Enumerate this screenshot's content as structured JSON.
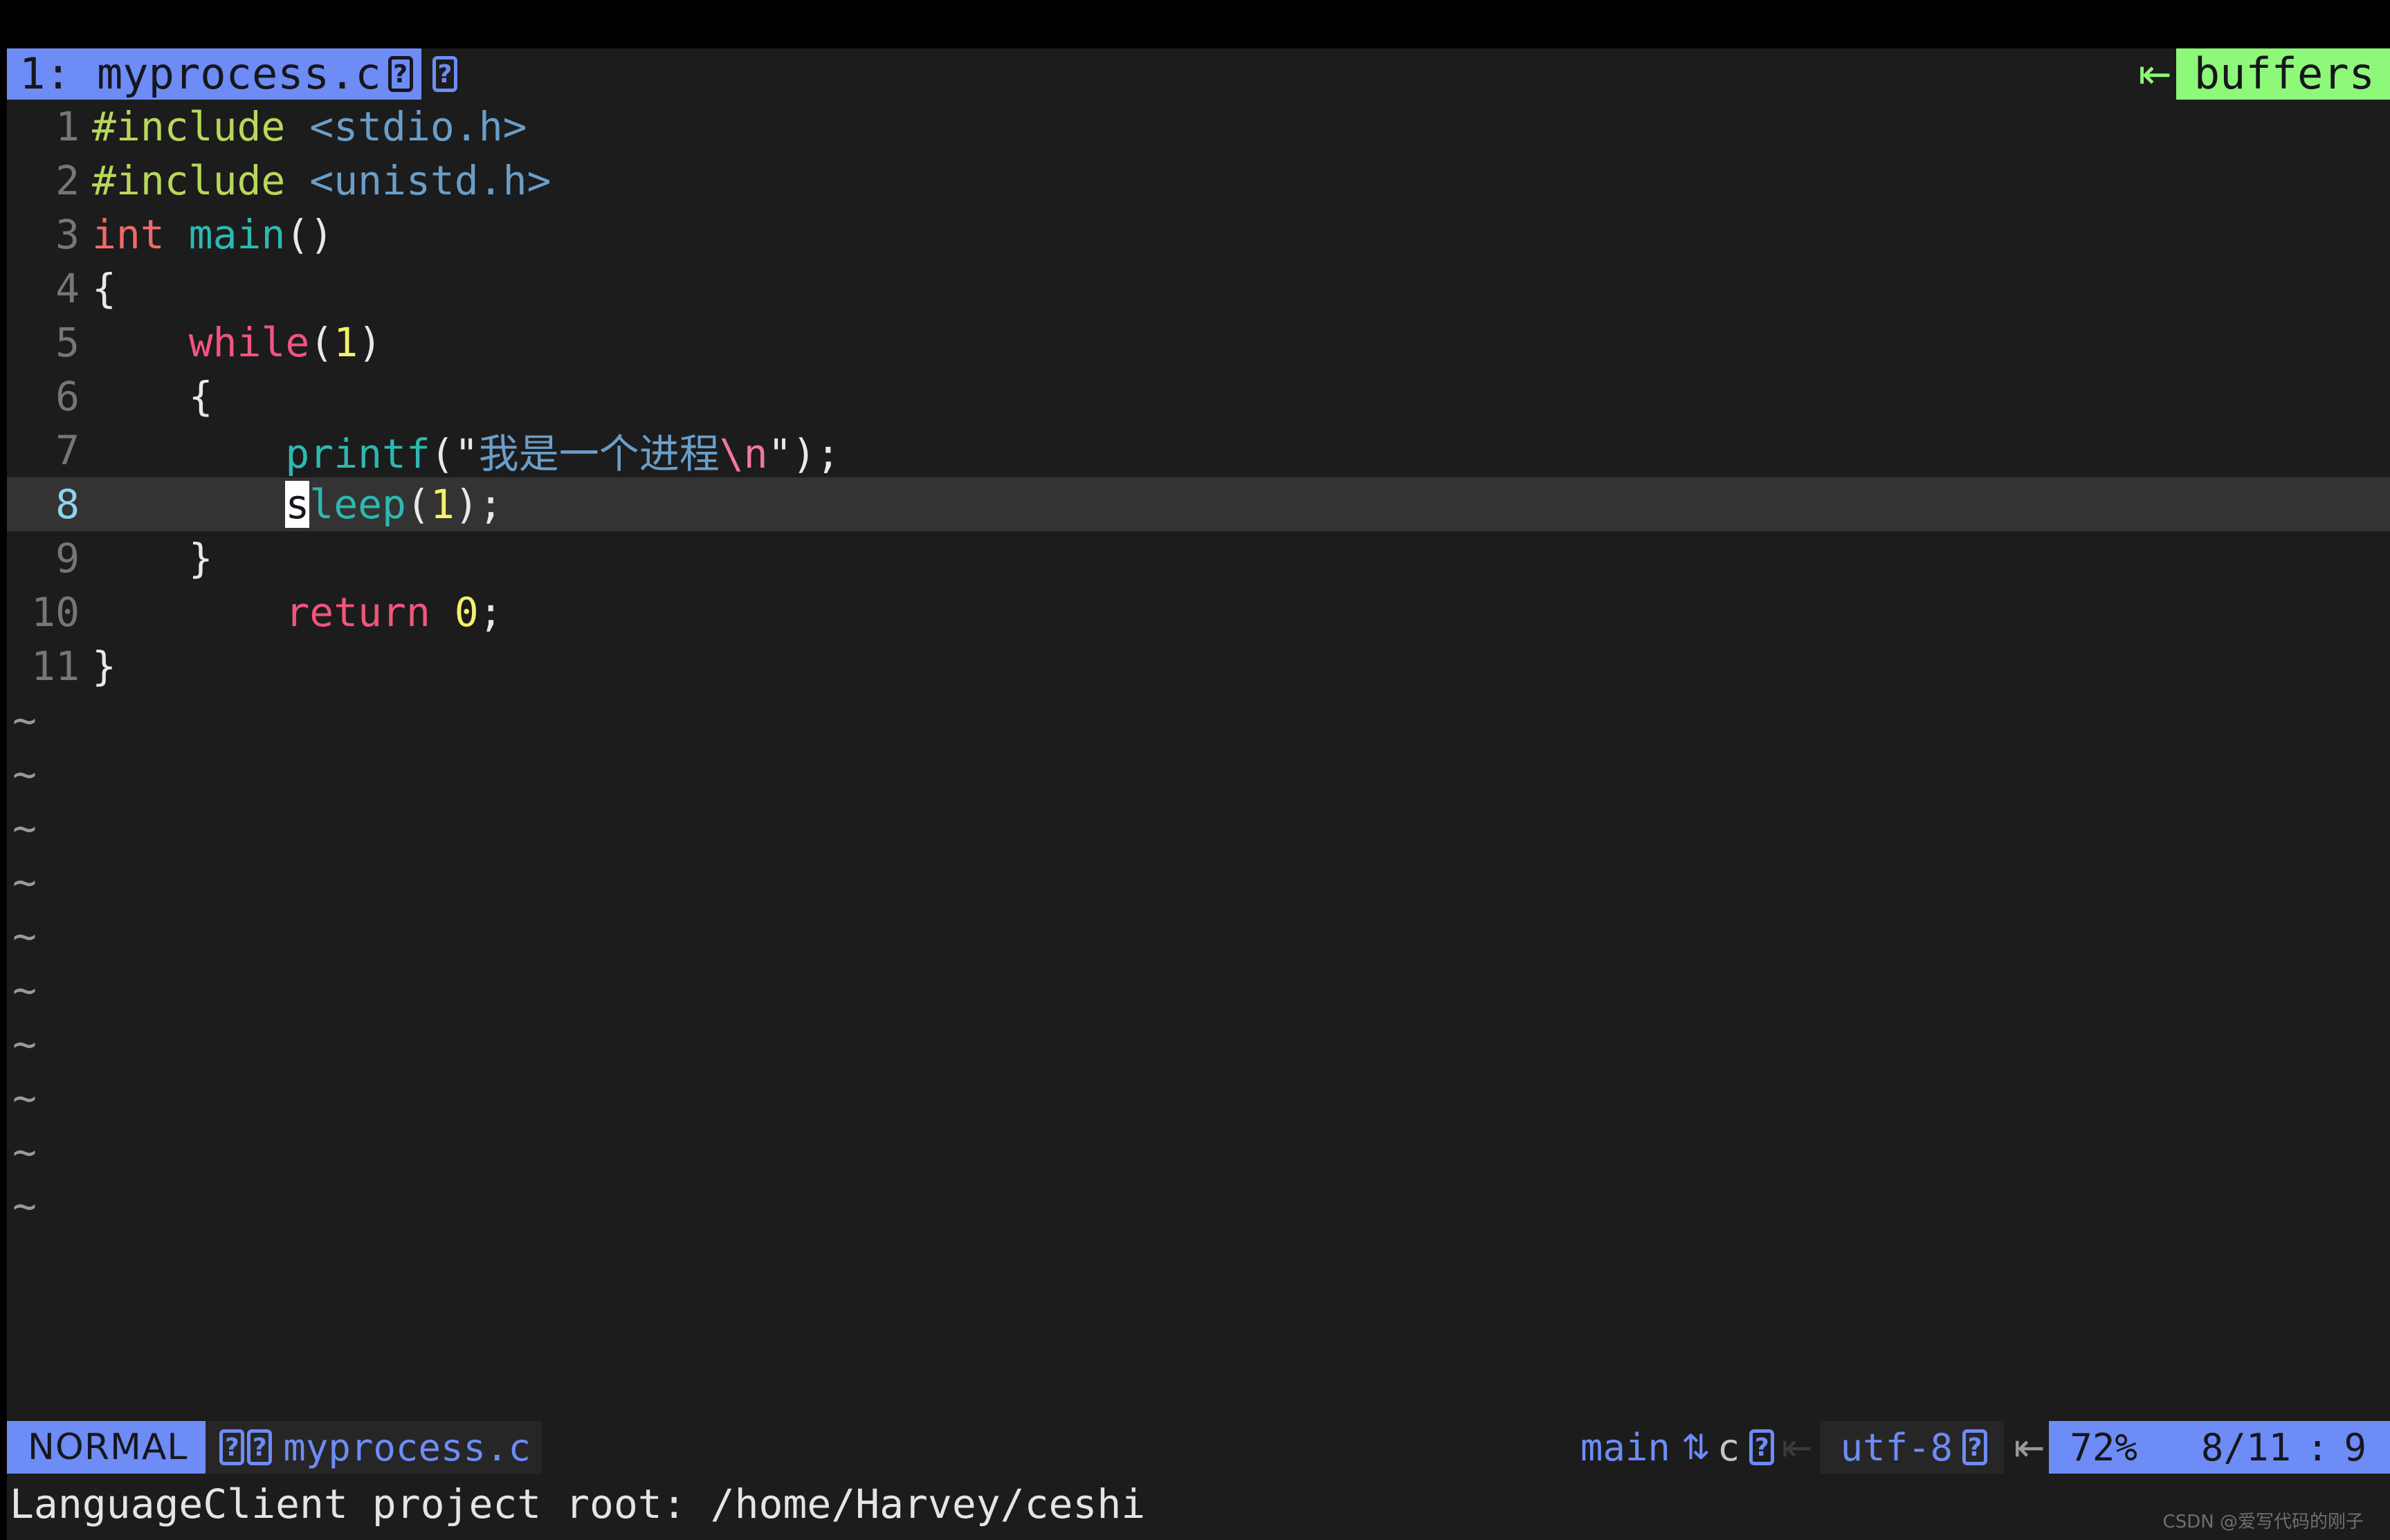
{
  "tabline": {
    "active_tab": "1: myprocess.c",
    "tab_glyph_1": "?",
    "tab_glyph_2": "?",
    "buffers_separator_icon": "buffers-separator-arrow-icon",
    "buffers_label": "buffers",
    "buffers_bg_color": "#8ef879",
    "active_tab_bg_color": "#6e8cf5"
  },
  "editor": {
    "filename": "myprocess.c",
    "cursor_line": 8,
    "cursor_col": 9,
    "total_lines": 11,
    "lines": [
      {
        "number": "1",
        "current": false
      },
      {
        "number": "2",
        "current": false
      },
      {
        "number": "3",
        "current": false
      },
      {
        "number": "4",
        "current": false
      },
      {
        "number": "5",
        "current": false
      },
      {
        "number": "6",
        "current": false
      },
      {
        "number": "7",
        "current": false
      },
      {
        "number": "8",
        "current": true
      },
      {
        "number": "9",
        "current": false
      },
      {
        "number": "10",
        "current": false
      },
      {
        "number": "11",
        "current": false
      }
    ],
    "source": {
      "l1_pre": "#include",
      "l1_inc": " <stdio.h>",
      "l2_pre": "#include",
      "l2_inc": " <unistd.h>",
      "l3_type": "int",
      "l3_fn": " main",
      "l3_punct": "()",
      "l4_brace": "{",
      "l5_indent": "    ",
      "l5_kw": "while",
      "l5_open": "(",
      "l5_num": "1",
      "l5_close": ")",
      "l6_indent": "    ",
      "l6_brace": "{",
      "l7_indent": "        ",
      "l7_fn": "printf",
      "l7_open": "(\"",
      "l7_str": "我是一个进程",
      "l7_esc": "\\n",
      "l7_close": "\");",
      "l8_indent": "        ",
      "l8_cursor_char": "s",
      "l8_fn": "leep",
      "l8_open": "(",
      "l8_num": "1",
      "l8_close": ");",
      "l9_indent": "    ",
      "l9_brace": "}",
      "l10_indent": "        ",
      "l10_kw": "return",
      "l10_num": " 0",
      "l10_semi": ";",
      "l11_brace": "}"
    },
    "filler_tilde": "~",
    "filler_count": 10,
    "colors": {
      "background": "#1c1c1c",
      "cursorline": "#333333",
      "line_number": "#767676",
      "current_line_number": "#8ed2f0",
      "preprocessor": "#b8d75b",
      "include_path": "#6a9ec9",
      "type": "#f16a6a",
      "function": "#2eb8b0",
      "punctuation": "#e8e8e8",
      "keyword": "#f2557f",
      "number": "#f5f06a",
      "string": "#6a9ec9",
      "escape": "#f2779f",
      "cursor": "#ffffff"
    }
  },
  "statusline": {
    "mode": "NORMAL",
    "file_glyph_1": "?",
    "file_glyph_2": "?",
    "filename": "myprocess.c",
    "git_branch": "main",
    "git_arrows_icon": "git-diff-arrows-icon",
    "filetype": "c",
    "filetype_glyph": "?",
    "separator_icon_left": "statusline-left-arrow-icon",
    "encoding": "utf-8",
    "encoding_glyph": "?",
    "separator_icon_right": "statusline-right-arrow-icon",
    "percent": "72%",
    "line_position": "8/11",
    "position_separator": ":",
    "column": "9",
    "mode_bg_color": "#6e8cf5",
    "position_bg_color": "#6e8cf5"
  },
  "message": {
    "text": "LanguageClient project root: /home/Harvey/ceshi"
  },
  "watermark": {
    "text": "CSDN @爱写代码的刚子"
  }
}
